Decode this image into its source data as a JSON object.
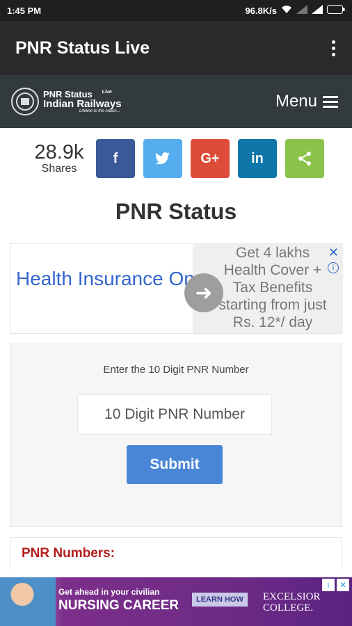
{
  "status_bar": {
    "time": "1:45 PM",
    "speed": "96.8K/s"
  },
  "app_bar": {
    "title": "PNR Status Live"
  },
  "site_header": {
    "logo_line1": "PNR Status",
    "logo_live": "Live",
    "logo_line2": "Indian Railways",
    "logo_tagline": "Lifeline to the nation...",
    "menu_label": "Menu"
  },
  "share": {
    "count": "28.9k",
    "count_label": "Shares",
    "buttons": [
      {
        "name": "facebook",
        "glyph": "f",
        "color": "#3b5998"
      },
      {
        "name": "twitter",
        "glyph": "t",
        "color": "#55acee"
      },
      {
        "name": "google-plus",
        "glyph": "G+",
        "color": "#dd4b39"
      },
      {
        "name": "linkedin",
        "glyph": "in",
        "color": "#0e76a8"
      },
      {
        "name": "share",
        "glyph": "<",
        "color": "#8bc34a"
      }
    ]
  },
  "page_title": "PNR Status",
  "ad_top": {
    "headline": "Health Insurance Online",
    "body": "Get 4 lakhs Health Cover + Tax Benefits starting from just Rs. 12*/ day"
  },
  "form": {
    "instruction": "Enter the 10 Digit PNR Number",
    "input_placeholder": "10 Digit PNR Number",
    "submit_label": "Submit"
  },
  "pnr_numbers_heading": "PNR Numbers:",
  "ad_bottom": {
    "line1": "Get ahead in your civilian",
    "line2": "NURSING CAREER",
    "cta": "LEARN HOW",
    "brand_line1": "EXCELSIOR",
    "brand_line2": "COLLEGE."
  }
}
